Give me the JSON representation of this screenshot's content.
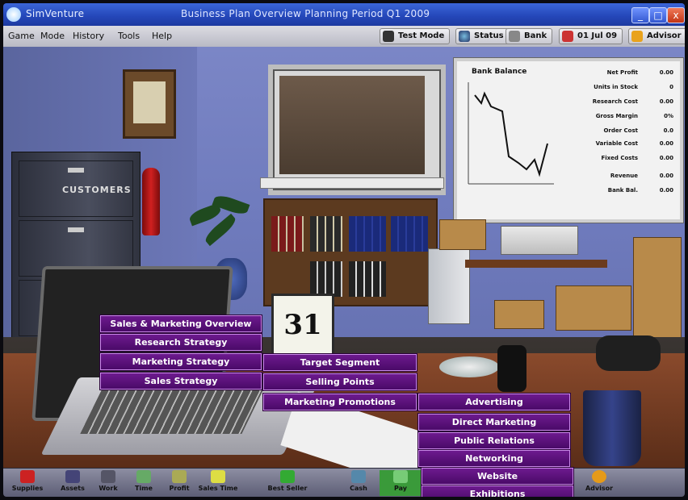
{
  "window": {
    "title": "SimVenture",
    "title_extra": "Business Plan   Overview   Planning Period   Q1 2009",
    "controls": [
      "_",
      "□",
      "x"
    ]
  },
  "menubar": {
    "menus": [
      "Game",
      "Mode",
      "History",
      "Tools",
      "Help"
    ],
    "tools": [
      {
        "label": "Test Mode",
        "icon": "clipboard-icon"
      },
      {
        "label": "Status",
        "icon": "globe-icon"
      },
      {
        "label": "Bank",
        "icon": "bank-icon"
      },
      {
        "label": "01 Jul 09",
        "icon": "calendar-icon"
      },
      {
        "label": "Advisor",
        "icon": "advisor-icon"
      }
    ]
  },
  "scene": {
    "cabinet_label": "CUSTOMERS",
    "calendar_day": "31"
  },
  "whiteboard": {
    "title": "Bank Balance",
    "rows": [
      {
        "k": "Net Profit",
        "v": "0.00"
      },
      {
        "k": "Units in Stock",
        "v": "0"
      },
      {
        "k": "Research Cost",
        "v": "0.00"
      },
      {
        "k": "Gross Margin",
        "v": "0%"
      },
      {
        "k": "Order Cost",
        "v": "0.0"
      },
      {
        "k": "Variable Cost",
        "v": "0.00"
      },
      {
        "k": "Fixed Costs",
        "v": "0.00"
      },
      {
        "k": "Revenue",
        "v": "0.00"
      },
      {
        "k": "Bank Bal.",
        "v": "0.00"
      }
    ]
  },
  "menus": {
    "level1": [
      "Sales & Marketing Overview",
      "Research Strategy",
      "Marketing Strategy",
      "Sales Strategy"
    ],
    "level2": [
      "Target Segment",
      "Selling Points",
      "Marketing Promotions"
    ],
    "level3": [
      "Advertising",
      "Direct Marketing",
      "Public Relations",
      "Networking",
      "Website",
      "Exhibitions"
    ]
  },
  "statusbar": {
    "items": [
      {
        "label": "Supplies",
        "icon": "supplies-icon"
      },
      {
        "label": "Assets",
        "icon": "assets-icon"
      },
      {
        "label": "Work",
        "icon": "work-icon"
      },
      {
        "label": "Time",
        "icon": "time-icon"
      },
      {
        "label": "Profit",
        "icon": "profit-icon"
      },
      {
        "label": "Sales Time",
        "icon": "sales-icon"
      },
      {
        "label": "Best Seller",
        "icon": "seller-icon"
      },
      {
        "label": "Cash",
        "icon": "cash-icon"
      },
      {
        "label": "Pay",
        "icon": "pay-icon"
      },
      {
        "label": "Advisor",
        "icon": "advisor-face-icon"
      }
    ]
  },
  "colors": {
    "menu_purple": "#5a0f7a",
    "menu_border": "#c98ae8",
    "titlebar_blue": "#2446b8"
  }
}
